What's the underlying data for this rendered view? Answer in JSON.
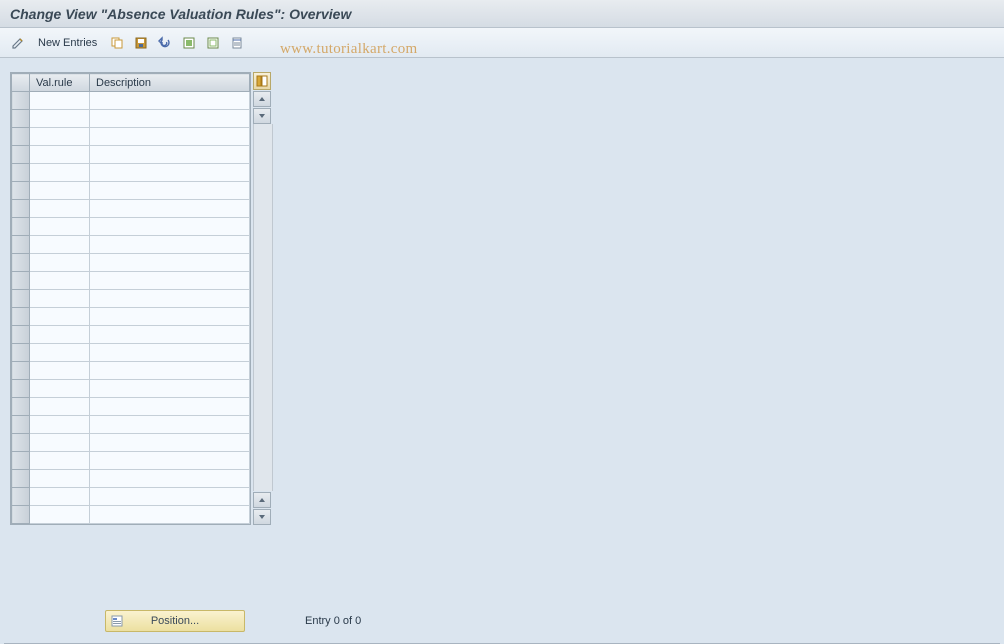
{
  "title": "Change View \"Absence Valuation Rules\": Overview",
  "toolbar": {
    "new_entries": "New Entries"
  },
  "watermark": "www.tutorialkart.com",
  "table": {
    "columns": [
      "Val.rule",
      "Description"
    ],
    "row_count": 24
  },
  "footer": {
    "position_label": "Position...",
    "entry_status": "Entry 0 of 0"
  }
}
